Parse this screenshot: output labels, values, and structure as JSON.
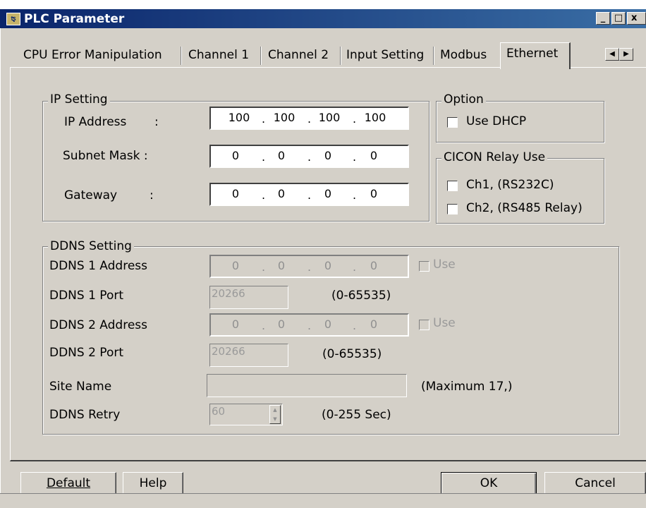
{
  "window": {
    "title": "PLC Parameter",
    "icon_text": "ꭧ",
    "minimize": "_",
    "maximize": "□",
    "close": "x"
  },
  "tabs": [
    "CPU Error Manipulation",
    "Channel 1",
    "Channel 2",
    "Input Setting",
    "Modbus",
    "Ethernet"
  ],
  "active_tab": "Ethernet",
  "tab_scroll": {
    "left": "◀",
    "right": "▶"
  },
  "ip_setting": {
    "title": "IP Setting",
    "ip_address": {
      "label": "IP Address",
      "colon": ":",
      "octets": [
        "100",
        "100",
        "100",
        "100"
      ]
    },
    "subnet_mask": {
      "label": "Subnet Mask :",
      "octets": [
        "0",
        "0",
        "0",
        "0"
      ]
    },
    "gateway": {
      "label": "Gateway",
      "colon": ":",
      "octets": [
        "0",
        "0",
        "0",
        "0"
      ]
    }
  },
  "option": {
    "title": "Option",
    "use_dhcp": {
      "label": "Use DHCP",
      "checked": false
    }
  },
  "cicon_relay": {
    "title": "CICON Relay Use",
    "ch1": {
      "label": "Ch1, (RS232C)",
      "checked": false
    },
    "ch2": {
      "label": "Ch2, (RS485 Relay)",
      "checked": false
    }
  },
  "ddns": {
    "title": "DDNS Setting",
    "ddns1_address": {
      "label": "DDNS 1 Address",
      "octets": [
        "0",
        "0",
        "0",
        "0"
      ],
      "use_label": "Use"
    },
    "ddns1_port": {
      "label": "DDNS 1 Port",
      "value": "20266",
      "range": "(0-65535)"
    },
    "ddns2_address": {
      "label": "DDNS 2 Address",
      "octets": [
        "0",
        "0",
        "0",
        "0"
      ],
      "use_label": "Use"
    },
    "ddns2_port": {
      "label": "DDNS 2 Port",
      "value": "20266",
      "range": "(0-65535)"
    },
    "site_name": {
      "label": "Site Name",
      "value": "",
      "hint": "(Maximum 17,)"
    },
    "retry": {
      "label": "DDNS Retry",
      "value": "60",
      "range": "(0-255 Sec)"
    }
  },
  "buttons": {
    "default": "Default",
    "help": "Help",
    "ok": "OK",
    "cancel": "Cancel"
  }
}
